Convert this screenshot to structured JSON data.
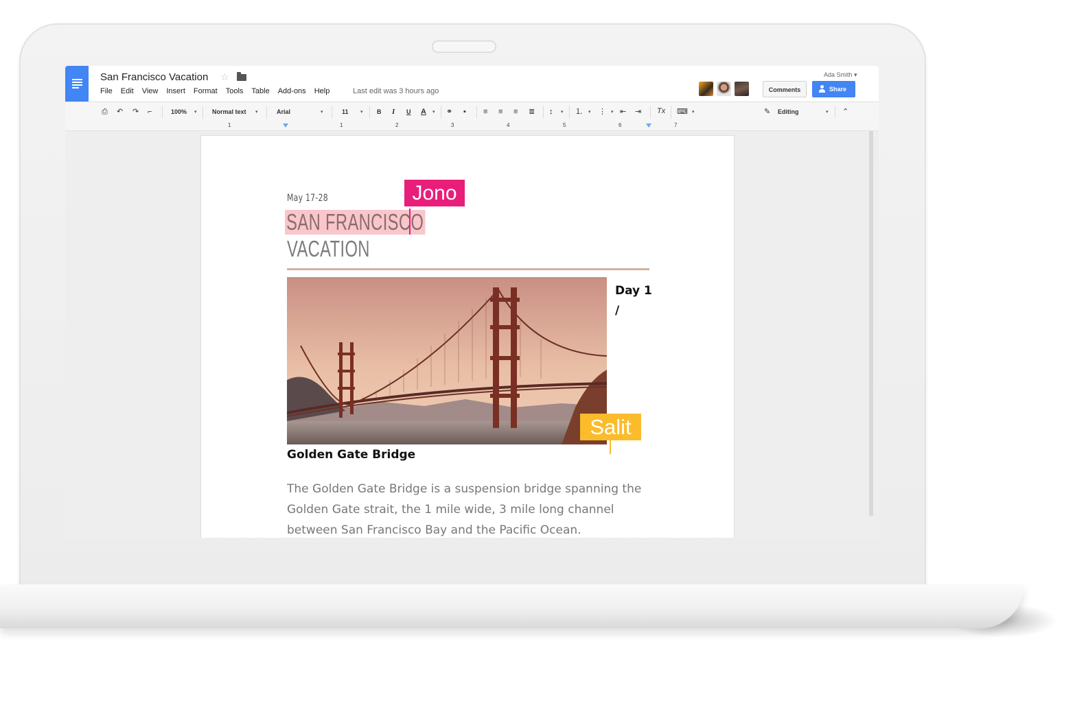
{
  "app": {
    "doc_title": "San Francisco Vacation",
    "menu": [
      "File",
      "Edit",
      "View",
      "Insert",
      "Format",
      "Tools",
      "Table",
      "Add-ons",
      "Help"
    ],
    "last_edit": "Last edit was 3 hours ago",
    "user_name": "Ada Smith",
    "comments_label": "Comments",
    "share_label": "Share"
  },
  "toolbar": {
    "zoom": "100%",
    "style": "Normal text",
    "font": "Arial",
    "size": "11",
    "bold": "B",
    "italic": "I",
    "underline": "U",
    "text_color": "A",
    "clear_format": "Tx",
    "mode": "Editing"
  },
  "ruler": [
    "1",
    "1",
    "2",
    "3",
    "4",
    "5",
    "6",
    "7"
  ],
  "document": {
    "date": "May 17-28",
    "title_line1": "SAN FRANCISCO",
    "title_line2": "VACATION",
    "day_label_line1": "Day 1",
    "day_label_line2": "/",
    "caption": "Golden Gate Bridge",
    "body": "The Golden Gate Bridge is a suspension bridge spanning the Golden Gate strait, the 1 mile wide, 3 mile long channel between San Francisco Bay and the Pacific Ocean."
  },
  "collaborators": {
    "jono": {
      "name": "Jono",
      "color": "#e91e7a"
    },
    "salit": {
      "name": "Salit",
      "color": "#fbbc2b"
    }
  },
  "colors": {
    "accent": "#4285f4",
    "title_highlight": "#f9c6cc",
    "rule": "#d2b39b"
  }
}
